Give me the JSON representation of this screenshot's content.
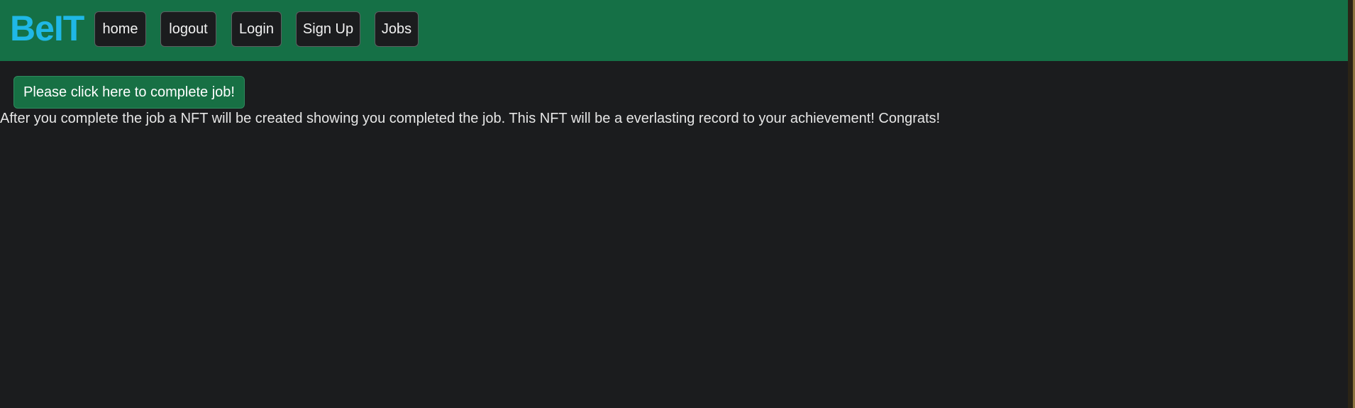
{
  "brand": {
    "name": "BeIT",
    "color": "#1fb8e6"
  },
  "colors": {
    "navbar_bg": "#157046",
    "page_bg": "#1b1c1e",
    "button_primary": "#177044",
    "nav_button_bg": "#1b1c1e"
  },
  "nav": {
    "items": [
      {
        "label": "home"
      },
      {
        "label": "logout"
      },
      {
        "label": "Login"
      },
      {
        "label": "Sign Up"
      },
      {
        "label": "Jobs"
      }
    ]
  },
  "main": {
    "complete_button_label": "Please click here to complete job!",
    "info_text": "After you complete the job a NFT will be created showing you completed the job. This NFT will be a everlasting record to your achievement! Congrats!"
  }
}
